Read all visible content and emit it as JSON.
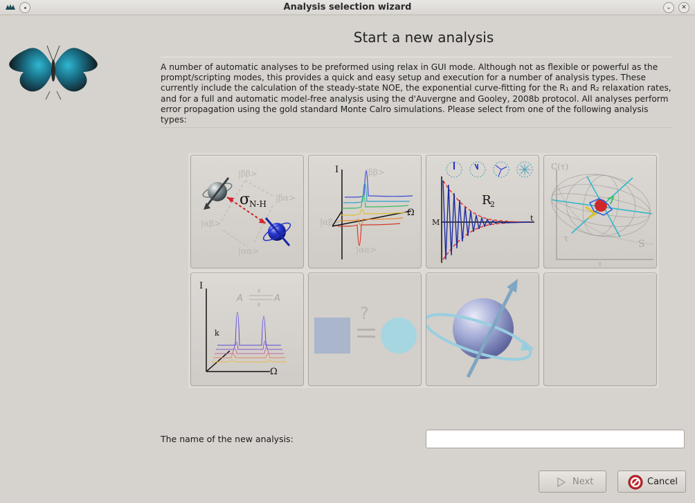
{
  "window": {
    "title": "Analysis selection wizard"
  },
  "header": {
    "title": "Start a new analysis",
    "description": "A number of automatic analyses to be preformed using relax in GUI mode.  Although not as flexible or powerful as the prompt/scripting modes, this provides a quick and easy setup and execution for a number of analysis types.  These currently include the calculation of the steady-state NOE, the exponential curve-fitting for the R₁ and R₂ relaxation rates, and for a full and automatic model-free analysis using the d'Auvergne and Gooley, 2008b protocol.  All analyses perform error propagation using the gold standard Monte Calro simulations.  Please select from one of the following analysis types:"
  },
  "tiles": {
    "noe": {
      "label_sigma": "σ",
      "label_sub": "N-H",
      "state_bb": "|ββ>",
      "state_ba": "|βα>",
      "state_ab": "|αβ>",
      "state_aa": "|αα>"
    },
    "r1": {
      "axis_i": "I",
      "axis_omega": "Ω",
      "state_bb": "|ββ>",
      "state_ab": "|αβ>",
      "state_aa": "|αα>"
    },
    "r2": {
      "label": "R",
      "label_sub": "2",
      "axis_m": "M",
      "axis_t": "t"
    },
    "model_free": {
      "axis_c": "C(τ)",
      "axis_tau": "τ",
      "label_te": "τ",
      "label_s2": "S"
    },
    "relax_disp": {
      "axis_i": "I",
      "axis_k": "k",
      "axis_omega": "Ω",
      "a1": "A",
      "a2": "A",
      "k1": "k",
      "k_1": "k"
    },
    "consistency": {
      "question": "?"
    }
  },
  "form": {
    "name_label": "The name of the new analysis:",
    "name_value": ""
  },
  "buttons": {
    "next": "Next",
    "cancel": "Cancel"
  },
  "colors": {
    "background": "#d6d2cd",
    "accent_blue": "#2c3fd0",
    "cancel_red": "#c0262c"
  }
}
